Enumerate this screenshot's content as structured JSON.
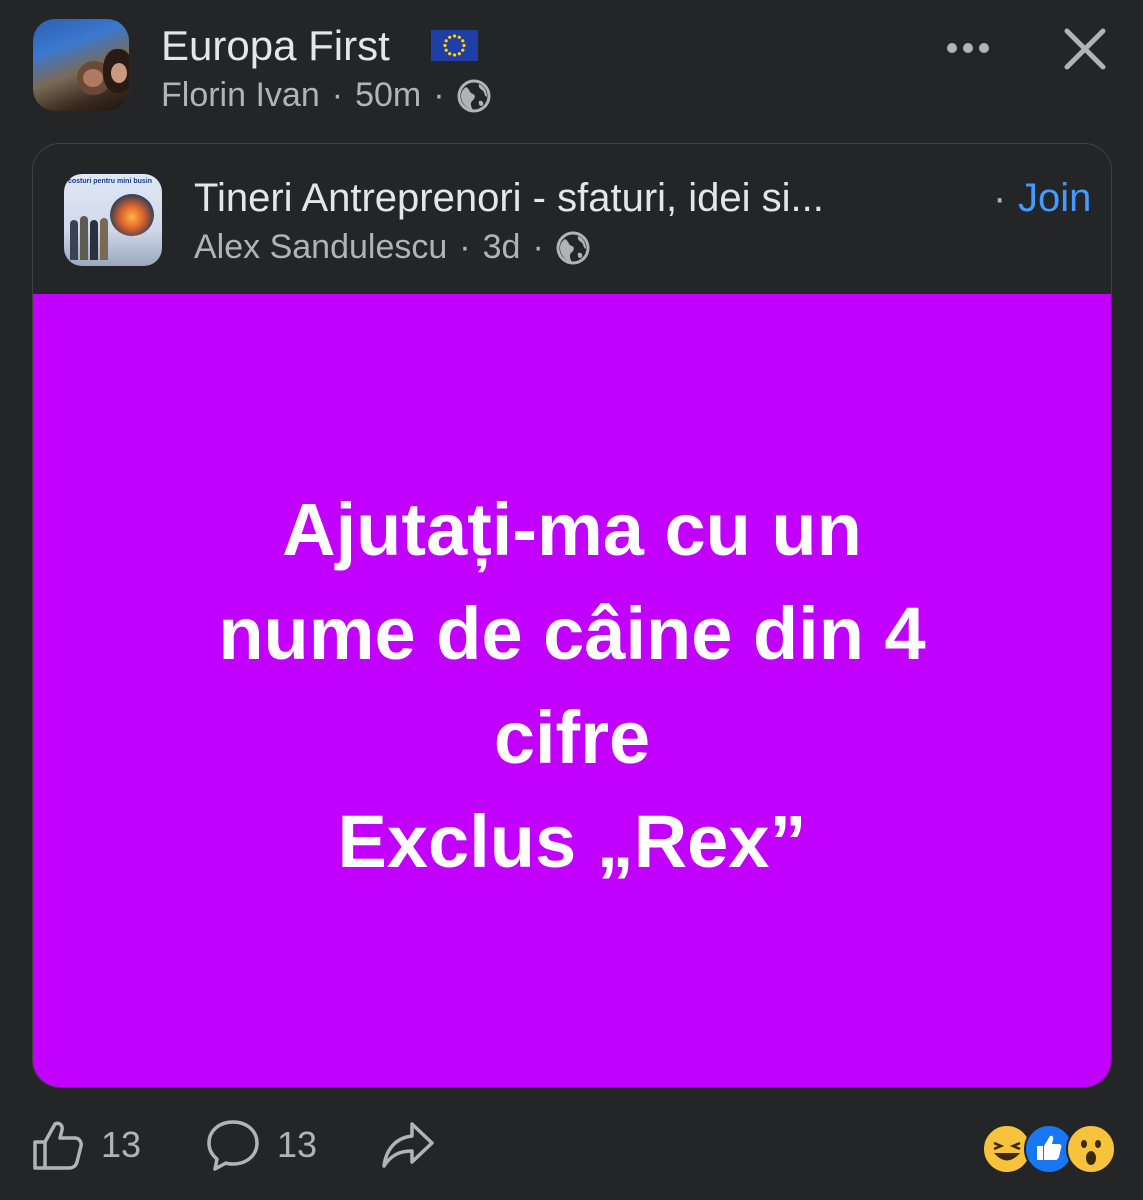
{
  "header": {
    "page_name": "Europa First",
    "flag_icon": "eu-flag-icon",
    "author": "Florin Ivan",
    "separator": "·",
    "time": "50m",
    "privacy_icon": "globe-icon"
  },
  "shared_post": {
    "group_name": "Tineri Antreprenori - sfaturi, idei si...",
    "separator": "·",
    "join_label": "Join",
    "author": "Alex Sandulescu",
    "time": "3d",
    "group_avatar_caption": "costuri pentru mini busin",
    "text": "Ajutați-ma cu un\nnume de câine din 4\ncifre\nExclus „Rex”",
    "background_color": "#c100fd"
  },
  "footer": {
    "like_count": "13",
    "comment_count": "13"
  },
  "colors": {
    "background": "#242526",
    "primary_text": "#e4e6eb",
    "secondary_text": "#b0b3b8",
    "link_blue": "#4599ff"
  }
}
